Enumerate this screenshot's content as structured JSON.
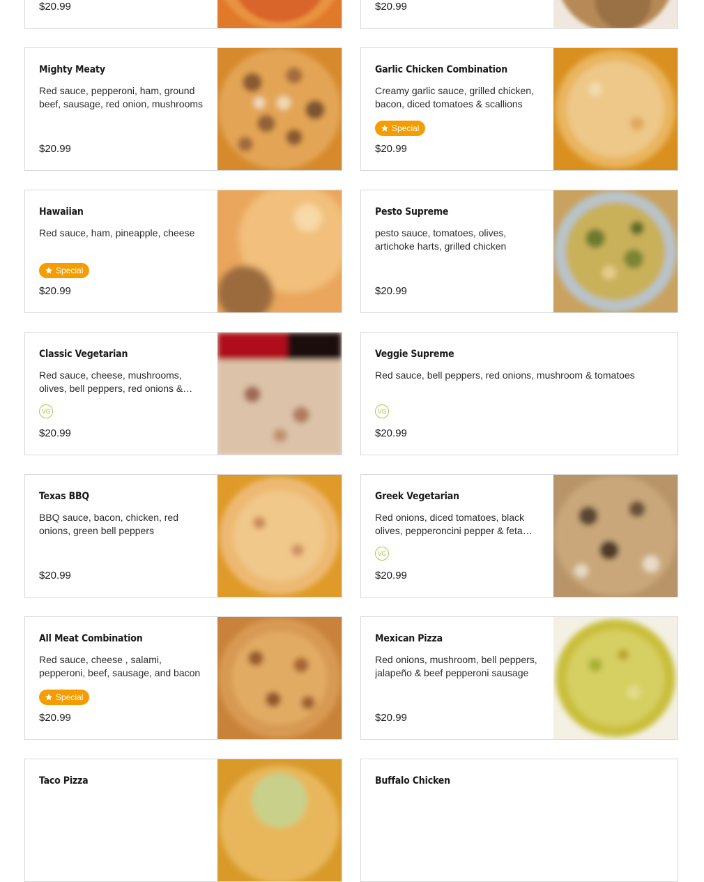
{
  "menu": {
    "items": [
      {
        "name": "",
        "description": "",
        "price": "$20.99",
        "badge": "",
        "photo": "pizza-photo-orange"
      },
      {
        "name": "",
        "description": "",
        "price": "$20.99",
        "badge": "",
        "photo": "pizza-photo-tan"
      },
      {
        "name": "Mighty Meaty",
        "description": "Red sauce, pepperoni, ham, ground beef, sausage, red onion, mushrooms",
        "price": "$20.99",
        "badge": "",
        "photo": "pizza-photo-meaty"
      },
      {
        "name": "Garlic Chicken Combination",
        "description": "Creamy garlic sauce, grilled chicken, bacon, diced tomatoes & scallions",
        "price": "$20.99",
        "badge": "Special",
        "photo": "pizza-photo-garlic-chicken"
      },
      {
        "name": "Hawaiian",
        "description": "Red sauce, ham, pineapple, cheese",
        "price": "$20.99",
        "badge": "Special",
        "photo": "pizza-photo-hawaiian"
      },
      {
        "name": "Pesto Supreme",
        "description": "pesto sauce, tomatoes, olives, artichoke harts, grilled chicken",
        "price": "$20.99",
        "badge": "",
        "photo": "pizza-photo-pesto"
      },
      {
        "name": "Classic Vegetarian",
        "description": "Red sauce, cheese, mushrooms, olives, bell peppers, red onions & tomatoes",
        "price": "$20.99",
        "badge": "VG",
        "photo": "pizza-photo-vegetarian"
      },
      {
        "name": "Veggie Supreme",
        "description": "Red sauce, bell peppers, red onions, mushroom & tomatoes",
        "price": "$20.99",
        "badge": "VG",
        "photo": ""
      },
      {
        "name": "Texas BBQ",
        "description": "BBQ sauce, bacon, chicken, red onions, green bell peppers",
        "price": "$20.99",
        "badge": "",
        "photo": "pizza-photo-bbq"
      },
      {
        "name": "Greek Vegetarian",
        "description": "Red onions, diced tomatoes, black olives, pepperoncini pepper & feta cheese",
        "price": "$20.99",
        "badge": "VG",
        "photo": "pizza-photo-greek"
      },
      {
        "name": "All Meat Combination",
        "description": "Red sauce, cheese , salami, pepperoni, beef, sausage, and bacon",
        "price": "$20.99",
        "badge": "Special",
        "photo": "pizza-photo-all-meat"
      },
      {
        "name": "Mexican Pizza",
        "description": "Red onions, mushroom, bell peppers, jalapeño & beef pepperoni sausage",
        "price": "$20.99",
        "badge": "",
        "photo": "pizza-photo-mexican"
      },
      {
        "name": "Taco Pizza",
        "description": "",
        "price": "",
        "badge": "",
        "photo": "pizza-photo-taco"
      },
      {
        "name": "Buffalo Chicken",
        "description": "",
        "price": "",
        "badge": "",
        "photo": ""
      }
    ]
  },
  "colors": {
    "special_badge": "#f59d00",
    "vg_badge": "#a8c94a",
    "border": "#d9d9d9"
  }
}
